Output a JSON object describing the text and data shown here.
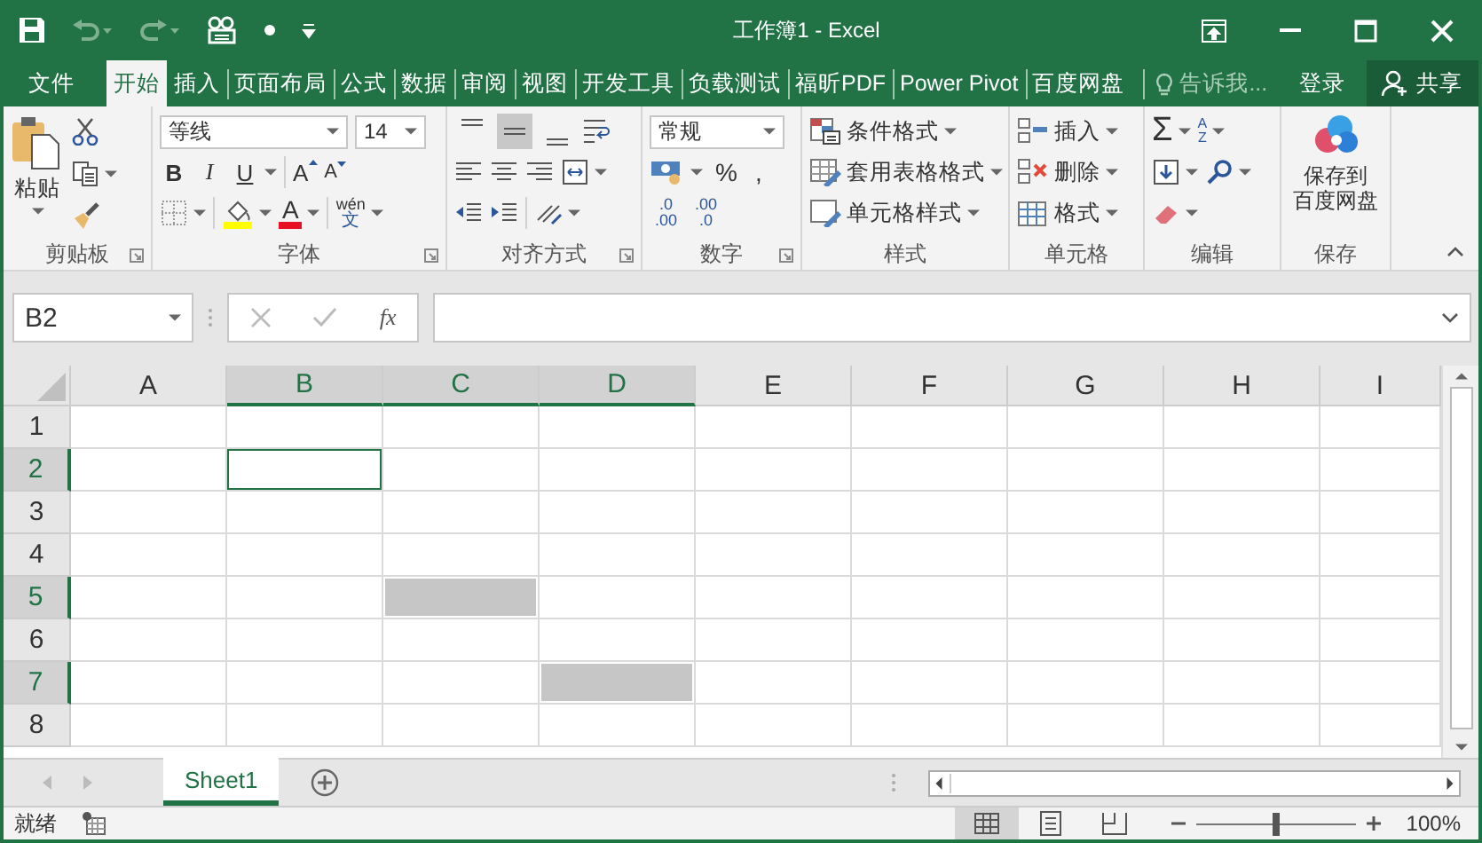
{
  "window": {
    "title": "工作簿1 - Excel"
  },
  "ribbon_tabs": [
    {
      "label": "文件",
      "selected": false
    },
    {
      "label": "开始",
      "selected": true
    },
    {
      "label": "插入",
      "selected": false
    },
    {
      "label": "页面布局",
      "selected": false
    },
    {
      "label": "公式",
      "selected": false
    },
    {
      "label": "数据",
      "selected": false
    },
    {
      "label": "审阅",
      "selected": false
    },
    {
      "label": "视图",
      "selected": false
    },
    {
      "label": "开发工具",
      "selected": false
    },
    {
      "label": "负载测试",
      "selected": false
    },
    {
      "label": "福昕PDF",
      "selected": false
    },
    {
      "label": "Power Pivot",
      "selected": false
    },
    {
      "label": "百度网盘",
      "selected": false
    }
  ],
  "tell_me": {
    "placeholder": "告诉我..."
  },
  "sign_in": "登录",
  "share": "共享",
  "ribbon": {
    "clipboard": {
      "paste": "粘贴",
      "label": "剪贴板"
    },
    "font": {
      "name": "等线",
      "size": "14",
      "styles": [
        {
          "kind": "bold",
          "label": "B"
        },
        {
          "kind": "italic",
          "label": "I"
        },
        {
          "kind": "underline",
          "label": "U"
        }
      ],
      "grow": "A",
      "shrink": "A",
      "font_color": "A",
      "phonetic": {
        "top": "wén",
        "bottom": "文"
      },
      "label": "字体"
    },
    "alignment": {
      "vertical": [
        {
          "kind": "top",
          "selected": false
        },
        {
          "kind": "middle",
          "selected": true
        },
        {
          "kind": "bottom",
          "selected": false
        }
      ],
      "label": "对齐方式"
    },
    "number": {
      "format": "常规",
      "percent": "%",
      "comma": ",",
      "decimals": [
        {
          "top": ".0",
          "bottom": ".00"
        },
        {
          "top": ".00",
          "bottom": ".0"
        }
      ],
      "label": "数字"
    },
    "styles": {
      "items": [
        {
          "kind": "conditional",
          "label": "条件格式"
        },
        {
          "kind": "table",
          "label": "套用表格格式"
        },
        {
          "kind": "cell",
          "label": "单元格样式"
        }
      ],
      "label": "样式"
    },
    "cells": {
      "items": [
        {
          "kind": "insert",
          "label": "插入"
        },
        {
          "kind": "delete",
          "label": "删除"
        },
        {
          "kind": "format",
          "label": "格式"
        }
      ],
      "label": "单元格"
    },
    "editing": {
      "sum": "Σ",
      "sort": {
        "top": "A",
        "bottom": "Z"
      },
      "label": "编辑"
    },
    "save": {
      "button_lines": [
        "保存到",
        "百度网盘"
      ],
      "label": "保存"
    }
  },
  "formula_bar": {
    "name_box": "B2",
    "function": "fx"
  },
  "grid": {
    "columns": [
      {
        "label": "A",
        "selected": false
      },
      {
        "label": "B",
        "selected": true
      },
      {
        "label": "C",
        "selected": true
      },
      {
        "label": "D",
        "selected": true
      },
      {
        "label": "E",
        "selected": false
      },
      {
        "label": "F",
        "selected": false
      },
      {
        "label": "G",
        "selected": false
      },
      {
        "label": "H",
        "selected": false
      },
      {
        "label": "I",
        "selected": false
      }
    ],
    "rows": [
      {
        "label": "1",
        "selected": false,
        "cells": [
          {
            "kind": "plain"
          },
          {
            "kind": "plain"
          },
          {
            "kind": "plain"
          },
          {
            "kind": "plain"
          },
          {
            "kind": "plain"
          },
          {
            "kind": "plain"
          },
          {
            "kind": "plain"
          },
          {
            "kind": "plain"
          },
          {
            "kind": "plain"
          }
        ]
      },
      {
        "label": "2",
        "selected": true,
        "cells": [
          {
            "kind": "plain"
          },
          {
            "kind": "active"
          },
          {
            "kind": "plain"
          },
          {
            "kind": "plain"
          },
          {
            "kind": "plain"
          },
          {
            "kind": "plain"
          },
          {
            "kind": "plain"
          },
          {
            "kind": "plain"
          },
          {
            "kind": "plain"
          }
        ]
      },
      {
        "label": "3",
        "selected": false,
        "cells": [
          {
            "kind": "plain"
          },
          {
            "kind": "plain"
          },
          {
            "kind": "plain"
          },
          {
            "kind": "plain"
          },
          {
            "kind": "plain"
          },
          {
            "kind": "plain"
          },
          {
            "kind": "plain"
          },
          {
            "kind": "plain"
          },
          {
            "kind": "plain"
          }
        ]
      },
      {
        "label": "4",
        "selected": false,
        "cells": [
          {
            "kind": "plain"
          },
          {
            "kind": "plain"
          },
          {
            "kind": "plain"
          },
          {
            "kind": "plain"
          },
          {
            "kind": "plain"
          },
          {
            "kind": "plain"
          },
          {
            "kind": "plain"
          },
          {
            "kind": "plain"
          },
          {
            "kind": "plain"
          }
        ]
      },
      {
        "label": "5",
        "selected": true,
        "cells": [
          {
            "kind": "plain"
          },
          {
            "kind": "plain"
          },
          {
            "kind": "selected"
          },
          {
            "kind": "plain"
          },
          {
            "kind": "plain"
          },
          {
            "kind": "plain"
          },
          {
            "kind": "plain"
          },
          {
            "kind": "plain"
          },
          {
            "kind": "plain"
          }
        ]
      },
      {
        "label": "6",
        "selected": false,
        "cells": [
          {
            "kind": "plain"
          },
          {
            "kind": "plain"
          },
          {
            "kind": "plain"
          },
          {
            "kind": "plain"
          },
          {
            "kind": "plain"
          },
          {
            "kind": "plain"
          },
          {
            "kind": "plain"
          },
          {
            "kind": "plain"
          },
          {
            "kind": "plain"
          }
        ]
      },
      {
        "label": "7",
        "selected": true,
        "cells": [
          {
            "kind": "plain"
          },
          {
            "kind": "plain"
          },
          {
            "kind": "plain"
          },
          {
            "kind": "selected"
          },
          {
            "kind": "plain"
          },
          {
            "kind": "plain"
          },
          {
            "kind": "plain"
          },
          {
            "kind": "plain"
          },
          {
            "kind": "plain"
          }
        ]
      },
      {
        "label": "8",
        "selected": false,
        "cells": [
          {
            "kind": "plain"
          },
          {
            "kind": "plain"
          },
          {
            "kind": "plain"
          },
          {
            "kind": "plain"
          },
          {
            "kind": "plain"
          },
          {
            "kind": "plain"
          },
          {
            "kind": "plain"
          },
          {
            "kind": "plain"
          },
          {
            "kind": "plain"
          }
        ]
      }
    ]
  },
  "sheet_tabs": [
    {
      "label": "Sheet1",
      "selected": true
    }
  ],
  "status_bar": {
    "status": "就绪",
    "views": [
      {
        "kind": "normal",
        "selected": true
      },
      {
        "kind": "page_layout",
        "selected": false
      },
      {
        "kind": "page_break",
        "selected": false
      }
    ],
    "zoom": {
      "level": 0.5,
      "reading": "100%"
    }
  }
}
